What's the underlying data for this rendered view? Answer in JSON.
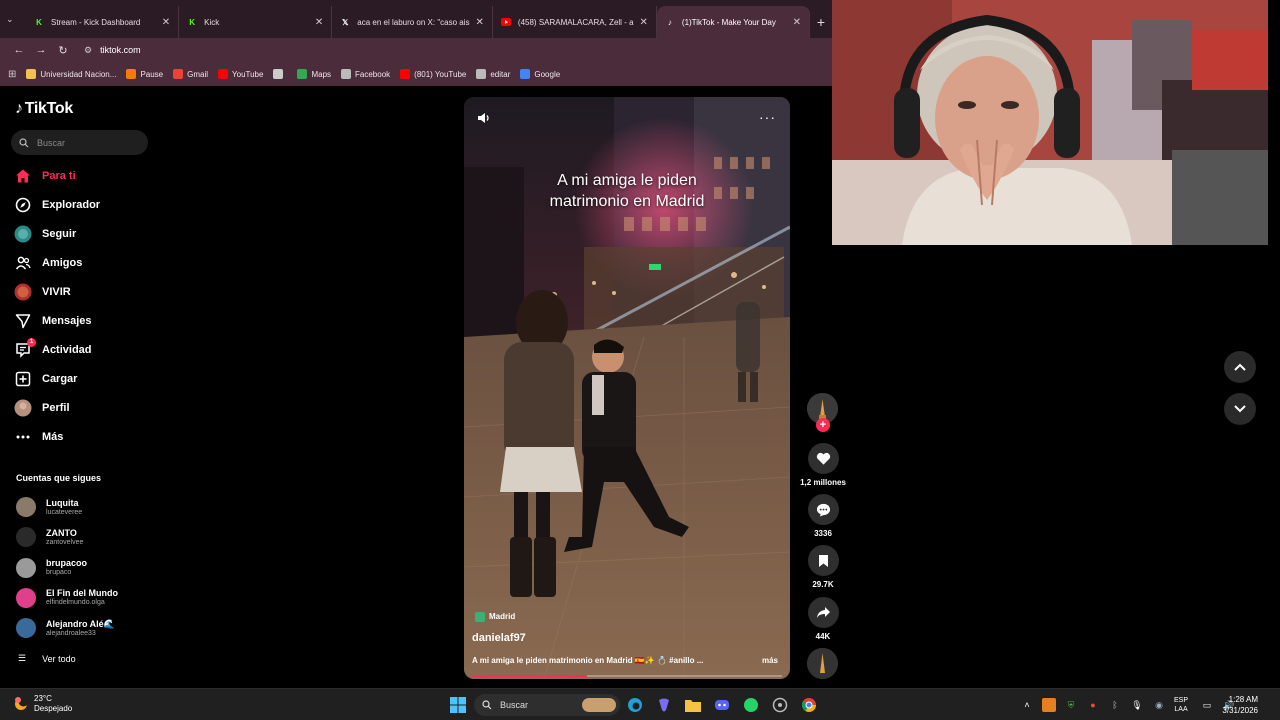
{
  "browser": {
    "tabs": [
      {
        "title": "Stream - Kick Dashboard",
        "icon": "kick-icon",
        "active": false
      },
      {
        "title": "Kick",
        "icon": "kick-icon",
        "active": false
      },
      {
        "title": "aca en el laburo on X: \"caso ais",
        "icon": "x-icon",
        "active": false
      },
      {
        "title": "(458) SARAMALACARA, Zell - a",
        "icon": "youtube-icon",
        "active": false
      },
      {
        "title": "(1)TikTok - Make Your Day",
        "icon": "tiktok-icon",
        "active": true
      }
    ],
    "url": "tiktok.com",
    "bookmarks": [
      {
        "label": "Universidad Nacion...",
        "icon": "bookmark-icon",
        "color": "#f2c14e"
      },
      {
        "label": "Pause",
        "icon": "pause-icon",
        "color": "#f57c00"
      },
      {
        "label": "Gmail",
        "icon": "gmail-icon",
        "color": "#ea4335"
      },
      {
        "label": "YouTube",
        "icon": "youtube-icon",
        "color": "#ff0000"
      },
      {
        "label": "",
        "icon": "arrow-icon",
        "color": "#cccccc"
      },
      {
        "label": "Maps",
        "icon": "maps-icon",
        "color": "#34a853"
      },
      {
        "label": "Facebook",
        "icon": "globe-icon",
        "color": "#bbbbbb"
      },
      {
        "label": "(801) YouTube",
        "icon": "youtube-icon",
        "color": "#ff0000"
      },
      {
        "label": "editar",
        "icon": "globe-icon",
        "color": "#bbbbbb"
      },
      {
        "label": "Google",
        "icon": "google-icon",
        "color": "#4285f4"
      }
    ]
  },
  "tiktok": {
    "logo": "TikTok",
    "search_placeholder": "Buscar",
    "nav": [
      {
        "label": "Para ti",
        "icon": "home-icon",
        "active": true
      },
      {
        "label": "Explorador",
        "icon": "compass-icon",
        "active": false
      },
      {
        "label": "Seguir",
        "icon": "following-avatar-icon",
        "active": false
      },
      {
        "label": "Amigos",
        "icon": "friends-icon",
        "active": false
      },
      {
        "label": "VIVIR",
        "icon": "live-avatar-icon",
        "active": false
      },
      {
        "label": "Mensajes",
        "icon": "send-icon",
        "active": false
      },
      {
        "label": "Actividad",
        "icon": "activity-icon",
        "active": false,
        "badge": "1"
      },
      {
        "label": "Cargar",
        "icon": "upload-icon",
        "active": false
      },
      {
        "label": "Perfil",
        "icon": "profile-avatar-icon",
        "active": false
      },
      {
        "label": "Más",
        "icon": "more-dots-icon",
        "active": false
      }
    ],
    "following_title": "Cuentas que sigues",
    "following": [
      {
        "name": "Luquita",
        "handle": "lucateveree"
      },
      {
        "name": "ZANTO",
        "handle": "zantovelvee"
      },
      {
        "name": "brupacoo",
        "handle": "brupaco"
      },
      {
        "name": "El Fin del Mundo",
        "handle": "elfindelmundo.olga"
      },
      {
        "name": "Alejandro Alé🌊",
        "handle": "alejandroalee33"
      }
    ],
    "see_all": "Ver todo"
  },
  "video": {
    "caption_line1": "A mi amiga le piden",
    "caption_line2": "matrimonio en Madrid",
    "location": "Madrid",
    "author": "danielaf97",
    "description": "A mi amiga le piden matrimonio en Madrid 🇪🇸✨ 💍 #anillo ...",
    "more": "más",
    "progress": 0.37
  },
  "actions": {
    "likes": "1,2 millones",
    "comments": "3336",
    "saves": "29.7K",
    "shares": "44K"
  },
  "taskbar": {
    "temperature": "23°C",
    "weather": "Despejado",
    "search_placeholder": "Buscar",
    "lang_line1": "ESP",
    "lang_line2": "LAA",
    "time": "1:28 AM",
    "date": "3/31/2026"
  }
}
